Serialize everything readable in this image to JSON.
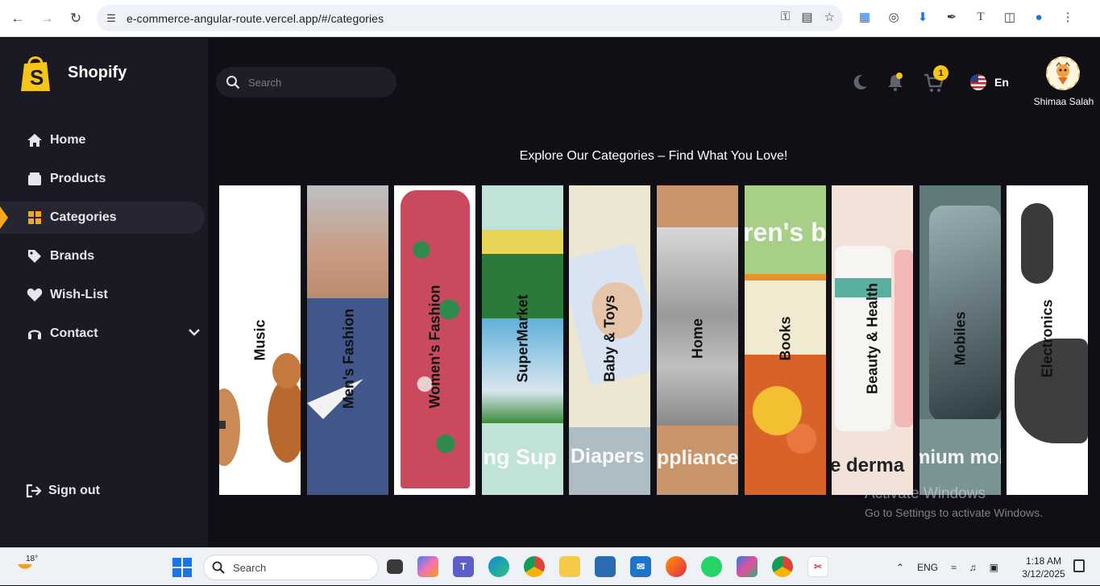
{
  "browser": {
    "url": "e-commerce-angular-route.vercel.app/#/categories"
  },
  "app": {
    "brand": "Shopify",
    "search_placeholder": "Search",
    "cart_count": "1",
    "language": "En",
    "user_name": "Shimaa Salah",
    "heading": "Explore Our Categories – Find What You Love!",
    "accent_color": "#f5a623"
  },
  "sidebar": {
    "items": [
      {
        "label": "Home",
        "icon": "home-icon"
      },
      {
        "label": "Products",
        "icon": "box-icon"
      },
      {
        "label": "Categories",
        "icon": "grid-icon",
        "active": true
      },
      {
        "label": "Brands",
        "icon": "tag-icon"
      },
      {
        "label": "Wish-List",
        "icon": "heart-icon"
      },
      {
        "label": "Contact",
        "icon": "headset-icon"
      }
    ],
    "signout": "Sign out"
  },
  "categories": [
    {
      "label": "Music",
      "image_text": ""
    },
    {
      "label": "Men's Fashion",
      "image_text": ""
    },
    {
      "label": "Women's Fashion",
      "image_text": ""
    },
    {
      "label": "SuperMarket",
      "image_text": "ing Sup"
    },
    {
      "label": "Baby & Toys",
      "image_text": "Diapers"
    },
    {
      "label": "Home",
      "image_text": "ppliance"
    },
    {
      "label": "Books",
      "image_text": "ren's b"
    },
    {
      "label": "Beauty & Health",
      "image_text": "e derma"
    },
    {
      "label": "Mobiles",
      "image_text": "mium mob"
    },
    {
      "label": "Electronics",
      "image_text": ""
    }
  ],
  "overlay": {
    "activate_title": "Activate Windows",
    "activate_sub": "Go to Settings to activate Windows."
  },
  "taskbar": {
    "temperature": "18°",
    "search": "Search",
    "language": "ENG",
    "time": "1:18 AM",
    "date": "3/12/2025"
  }
}
